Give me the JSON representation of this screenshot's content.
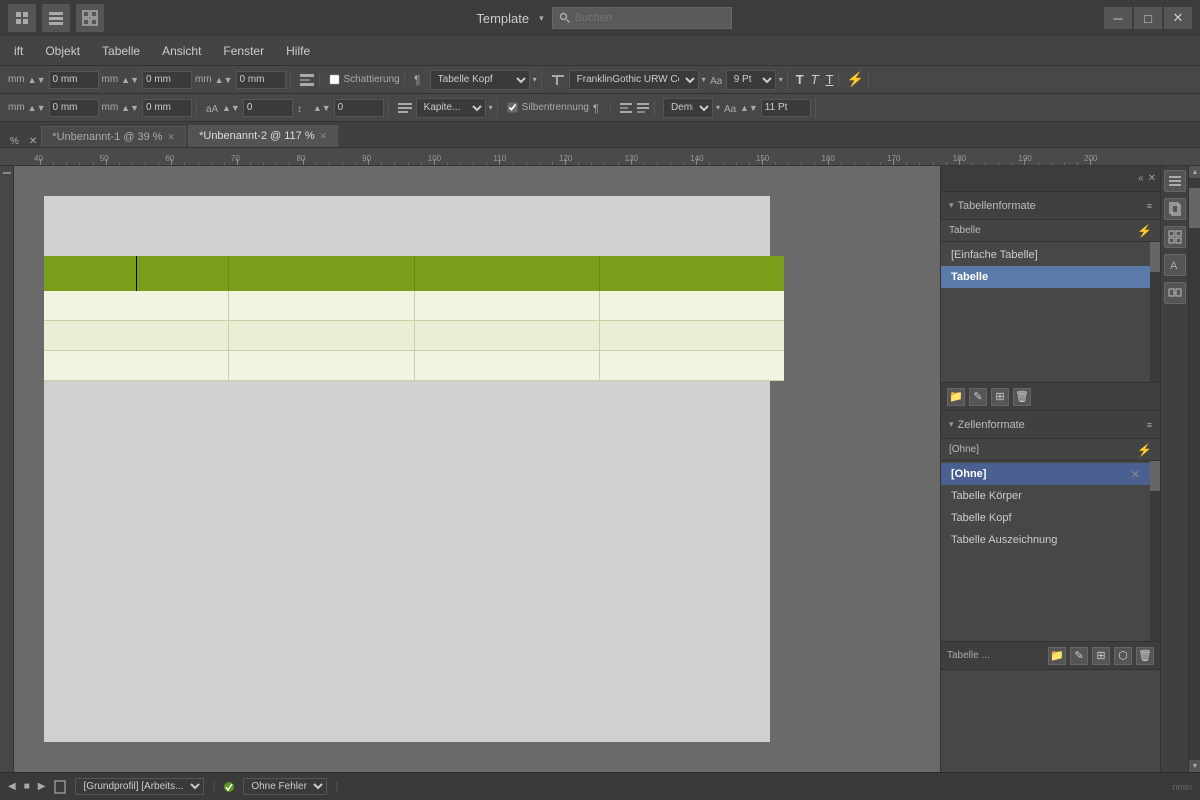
{
  "titlebar": {
    "template_label": "Template",
    "search_placeholder": "Suchen",
    "btn_minimize": "─",
    "btn_maximize": "□",
    "btn_close": "✕"
  },
  "menubar": {
    "items": [
      "ift",
      "Objekt",
      "Tabelle",
      "Ansicht",
      "Fenster",
      "Hilfe"
    ]
  },
  "toolbar1": {
    "val1": "0 mm",
    "val2": "0 mm",
    "val3": "0 mm",
    "checkbox1_label": "Schattierung",
    "dropdown1": "Tabelle Kopf",
    "dropdown2": "FranklinGothic URW Co",
    "size1": "9 Pt",
    "checkbox2_label": "Silbentrennung",
    "dropdown3": "Demi",
    "size2": "11 Pt"
  },
  "toolbar2": {
    "val1": "0 mm",
    "val2": "0",
    "val3": "0",
    "dropdown1": "Kapite..."
  },
  "tabs": [
    {
      "label": "*Unbenannt-1 @ 39 %",
      "active": false
    },
    {
      "label": "*Unbenannt-2 @ 117 %",
      "active": true
    }
  ],
  "tabellenformate_panel": {
    "title": "Tabellenformate",
    "subheader": "Tabelle",
    "items": [
      {
        "label": "[Einfache Tabelle]",
        "selected": false
      },
      {
        "label": "Tabelle",
        "selected": true
      }
    ],
    "lightning_icon": "⚡"
  },
  "zellenformate_panel": {
    "title": "Zellenformate",
    "subheader": "[Ohne]",
    "items": [
      {
        "label": "[Ohne]",
        "selected": true,
        "has_x": true
      },
      {
        "label": "Tabelle Körper",
        "selected": false
      },
      {
        "label": "Tabelle Kopf",
        "selected": false
      },
      {
        "label": "Tabelle Auszeichnung",
        "selected": false
      }
    ],
    "lightning_icon": "⚡",
    "footer_label": "Tabelle ..."
  },
  "statusbar": {
    "profile": "[Grundprofil] [Arbeits...",
    "status": "Ohne Fehler",
    "nav_prev": "◀",
    "nav_next": "▶"
  },
  "ruler": {
    "marks": [
      40,
      50,
      60,
      70,
      80,
      90,
      100,
      110,
      120,
      130,
      140,
      150,
      160,
      170,
      180,
      190,
      200
    ]
  },
  "right_sidebar_icons": [
    "▶",
    "≡",
    "⊞",
    "⊡",
    "⊞"
  ],
  "panel_footer_buttons": [
    "📁",
    "✎",
    "⊞",
    "⬡",
    "🗑"
  ]
}
